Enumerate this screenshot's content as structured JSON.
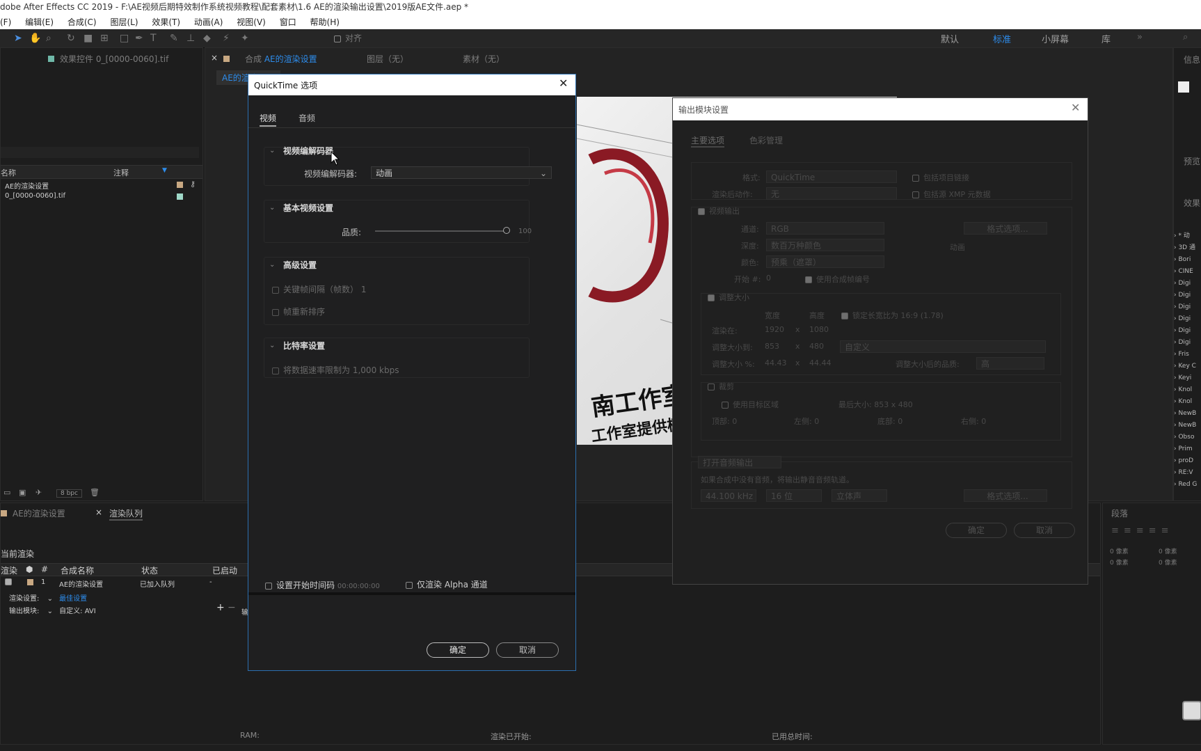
{
  "window": {
    "title": "dobe After Effects CC 2019 - F:\\AE视频后期特效制作系统视频教程\\配套素材\\1.6 AE的渲染输出设置\\2019版AE文件.aep *"
  },
  "menu": [
    "(F)",
    "编辑(E)",
    "合成(C)",
    "图层(L)",
    "效果(T)",
    "动画(A)",
    "视图(V)",
    "窗口",
    "帮助(H)"
  ],
  "toolbar": {
    "align_label": "对齐",
    "workspaces": [
      "默认",
      "标准",
      "小屏幕",
      "库"
    ],
    "active_workspace": "标准"
  },
  "project_panel": {
    "effects_tab": "效果控件 0_[0000-0060].tif",
    "col_name": "名称",
    "col_comment": "注释",
    "items": [
      "AE的渲染设置",
      "0_[0000-0060].tif"
    ],
    "bpc": "8 bpc"
  },
  "comp_panel": {
    "tab_comp": "合成",
    "tab_comp_name": "AE的渲染设置",
    "tab_layer": "图层（无）",
    "tab_footage": "素材（无）",
    "sub_tab": "AE的渲染设置",
    "preview_text_1": "南工作室",
    "preview_text_2": "工作室提供模型"
  },
  "right_panels": {
    "info": "信息",
    "preview": "预览",
    "effects": "效果",
    "paragraph": "段落",
    "effect_items": [
      "* 动",
      "3D 通",
      "Bori",
      "CINE",
      "Digi",
      "Digi",
      "Digi",
      "Digi",
      "Digi",
      "Digi",
      "Fris",
      "Key C",
      "Keyi",
      "Knol",
      "Knol",
      "NewB",
      "NewB",
      "Obso",
      "Prim",
      "proD",
      "RE:V",
      "Red G"
    ],
    "para_a": "0 像素",
    "para_b": "0 像素",
    "para_c": "0 像素",
    "para_d": "0 像素"
  },
  "render_queue": {
    "tab_comp": "AE的渲染设置",
    "tab_queue": "渲染队列",
    "current_render": "当前渲染",
    "col_render": "渲染",
    "col_num": "#",
    "col_comp": "合成名称",
    "col_status": "状态",
    "col_started": "已启动",
    "row_num": "1",
    "row_comp": "AE的渲染设置",
    "row_status": "已加入队列",
    "row_started": "-",
    "render_settings_label": "渲染设置:",
    "render_settings_value": "最佳设置",
    "output_module_label": "输出模块:",
    "output_module_value": "自定义: AVI",
    "output_to": "输",
    "status_ram": "RAM:",
    "status_started": "渲染已开始:",
    "status_elapsed": "已用总时间:"
  },
  "qt_dialog": {
    "title": "QuickTime 选项",
    "tabs": [
      "视频",
      "音频"
    ],
    "sec_codec": "视频编解码器",
    "codec_label": "视频编解码器:",
    "codec_value": "动画",
    "sec_basic": "基本视频设置",
    "quality_label": "品质:",
    "quality_value": "100",
    "quality_fraction": 1.0,
    "sec_advanced": "高级设置",
    "keyframe_label": "关键帧间隔（帧数）",
    "keyframe_value": "1",
    "reorder_label": "帧重新排序",
    "sec_bitrate": "比特率设置",
    "bitrate_label": "将数据速率限制为",
    "bitrate_value": "1,000",
    "bitrate_unit": "kbps",
    "start_tc_label": "设置开始时间码",
    "start_tc_value": "00:00:00:00",
    "alpha_label": "仅渲染 Alpha 通道",
    "ok": "确定",
    "cancel": "取消"
  },
  "om_dialog": {
    "title": "输出模块设置",
    "tabs": [
      "主要选项",
      "色彩管理"
    ],
    "format_label": "格式:",
    "format_value": "QuickTime",
    "include_link": "包括项目链接",
    "post_render_label": "渲染后动作:",
    "post_render_value": "无",
    "include_xmp": "包括源 XMP 元数据",
    "video_output": "视频输出",
    "channels_label": "通道:",
    "channels_value": "RGB",
    "format_options": "格式选项...",
    "depth_label": "深度:",
    "depth_value": "数百万种颜色",
    "codec_note": "动画",
    "color_label": "颜色:",
    "color_value": "预乘（遮罩）",
    "start_label": "开始 #:",
    "start_value": "0",
    "use_comp_frame": "使用合成帧编号",
    "resize": "调整大小",
    "width_label": "宽度",
    "height_label": "高度",
    "lock_ratio": "锁定长宽比为 16:9 (1.78)",
    "render_at_label": "渲染在:",
    "render_w": "1920",
    "render_h": "1080",
    "resize_to_label": "调整大小到:",
    "resize_w": "853",
    "resize_h": "480",
    "resize_preset": "自定义",
    "resize_pct_label": "调整大小 %:",
    "pct_w": "44.43",
    "pct_h": "44.44",
    "resize_quality_label": "调整大小后的品质:",
    "resize_quality": "高",
    "crop": "裁剪",
    "use_roi": "使用目标区域",
    "final_size": "最后大小: 853 x 480",
    "top": "顶部:",
    "top_v": "0",
    "left": "左侧:",
    "left_v": "0",
    "bottom": "底部:",
    "bottom_v": "0",
    "right": "右侧:",
    "right_v": "0",
    "audio_output": "打开音频输出",
    "audio_note": "如果合成中没有音频，将输出静音音频轨道。",
    "sample_rate": "44.100 kHz",
    "bit_depth": "16 位",
    "stereo": "立体声",
    "audio_format_options": "格式选项...",
    "ok": "确定",
    "cancel": "取消"
  }
}
